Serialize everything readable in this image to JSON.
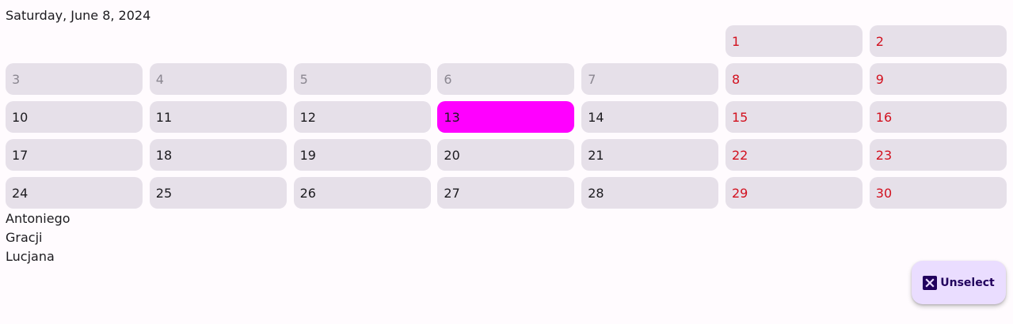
{
  "header": {
    "date_title": "Saturday, June 8, 2024"
  },
  "calendar": {
    "month": "June 2024",
    "selected_day": "13",
    "cells": [
      {
        "day": "",
        "type": "empty"
      },
      {
        "day": "",
        "type": "empty"
      },
      {
        "day": "",
        "type": "empty"
      },
      {
        "day": "",
        "type": "empty"
      },
      {
        "day": "",
        "type": "empty"
      },
      {
        "day": "1",
        "type": "weekend"
      },
      {
        "day": "2",
        "type": "weekend"
      },
      {
        "day": "3",
        "type": "dim"
      },
      {
        "day": "4",
        "type": "dim"
      },
      {
        "day": "5",
        "type": "dim"
      },
      {
        "day": "6",
        "type": "dim"
      },
      {
        "day": "7",
        "type": "dim"
      },
      {
        "day": "8",
        "type": "weekend"
      },
      {
        "day": "9",
        "type": "weekend"
      },
      {
        "day": "10",
        "type": "normal"
      },
      {
        "day": "11",
        "type": "normal"
      },
      {
        "day": "12",
        "type": "normal"
      },
      {
        "day": "13",
        "type": "selected"
      },
      {
        "day": "14",
        "type": "normal"
      },
      {
        "day": "15",
        "type": "weekend"
      },
      {
        "day": "16",
        "type": "weekend"
      },
      {
        "day": "17",
        "type": "normal"
      },
      {
        "day": "18",
        "type": "normal"
      },
      {
        "day": "19",
        "type": "normal"
      },
      {
        "day": "20",
        "type": "normal"
      },
      {
        "day": "21",
        "type": "normal"
      },
      {
        "day": "22",
        "type": "weekend"
      },
      {
        "day": "23",
        "type": "weekend"
      },
      {
        "day": "24",
        "type": "normal"
      },
      {
        "day": "25",
        "type": "normal"
      },
      {
        "day": "26",
        "type": "normal"
      },
      {
        "day": "27",
        "type": "normal"
      },
      {
        "day": "28",
        "type": "normal"
      },
      {
        "day": "29",
        "type": "weekend"
      },
      {
        "day": "30",
        "type": "weekend"
      }
    ]
  },
  "name_days": [
    "Antoniego",
    "Gracji",
    "Lucjana"
  ],
  "fab": {
    "label": "Unselect",
    "icon": "close-icon"
  },
  "colors": {
    "cell_background": "#e6e0e9",
    "selected": "#ff00ff",
    "weekend_text": "#d2111f",
    "dim_text": "#8b8791",
    "fab_background": "#eaddff",
    "fab_content": "#21005d"
  }
}
